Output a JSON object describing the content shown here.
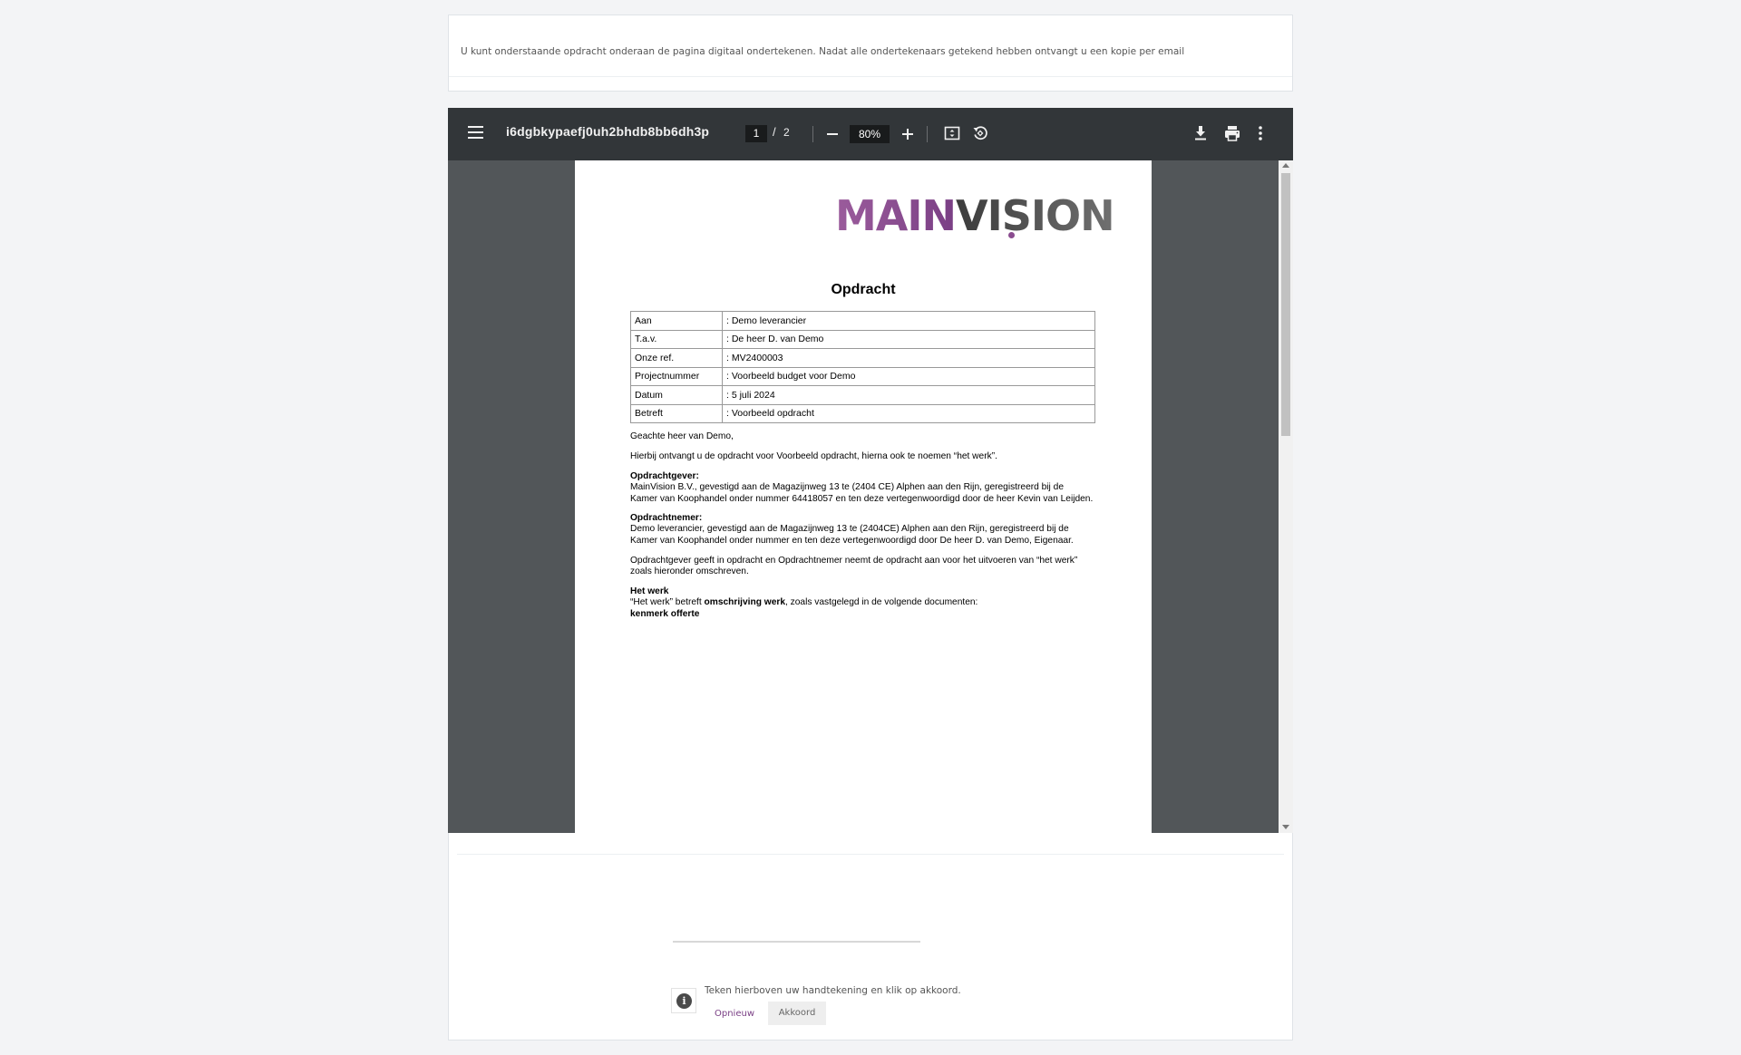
{
  "notice": {
    "text": "U kunt onderstaande opdracht onderaan de pagina digitaal ondertekenen. Nadat alle ondertekenaars getekend hebben ontvangt u een kopie per email"
  },
  "viewer": {
    "title": "i6dgbkypaefj0uh2bhdb8bb6dh3p",
    "page_current": "1",
    "page_separator": "/",
    "page_total": "2",
    "zoom": "80%",
    "icons": [
      "menu-icon",
      "zoom-out-icon",
      "zoom-in-icon",
      "fit-page-icon",
      "rotate-icon",
      "download-icon",
      "print-icon",
      "more-options-icon"
    ]
  },
  "document": {
    "logo_main": "MAIN",
    "logo_vision": "VISION",
    "heading": "Opdracht",
    "table": [
      {
        "key": "Aan",
        "value": ": Demo leverancier"
      },
      {
        "key": "T.a.v.",
        "value": ": De heer D. van Demo"
      },
      {
        "key": "Onze ref.",
        "value": ": MV2400003"
      },
      {
        "key": "Projectnummer",
        "value": ": Voorbeeld budget voor Demo"
      },
      {
        "key": "Datum",
        "value": ": 5 juli 2024"
      },
      {
        "key": "Betreft",
        "value": ": Voorbeeld opdracht"
      }
    ],
    "salutation": "Geachte heer van Demo,",
    "intro": "Hierbij ontvangt u de opdracht voor Voorbeeld opdracht, hierna ook te noemen “het werk”.",
    "client_heading": "Opdrachtgever:",
    "client_line1": "MainVision B.V., gevestigd aan de Magazijnweg 13 te (2404 CE) Alphen aan den Rijn, geregistreerd bij de",
    "client_line2": "Kamer van Koophandel onder nummer 64418057 en ten deze vertegenwoordigd door de heer Kevin van Leijden.",
    "contractor_heading": "Opdrachtnemer:",
    "contractor_line1": "Demo leverancier, gevestigd aan de Magazijnweg 13 te (2404CE) Alphen aan den Rijn, geregistreerd bij de",
    "contractor_line2": "Kamer van Koophandel onder nummer   en ten deze vertegenwoordigd door De heer D. van Demo, Eigenaar.",
    "assignment_line1": "Opdrachtgever geeft in opdracht en Opdrachtnemer neemt de opdracht aan voor het uitvoeren van “het werk”",
    "assignment_line2": "zoals hieronder omschreven.",
    "work_heading": "Het werk",
    "work_prefix": "“Het werk” betreft ",
    "work_bold": "omschrijving werk",
    "work_suffix": ", zoals vastgelegd in de volgende documenten:",
    "work_ref": "kenmerk offerte"
  },
  "signature": {
    "hint": "Teken hierboven uw handtekening en klik op akkoord.",
    "reset_label": "Opnieuw",
    "accept_label": "Akkoord",
    "info_glyph": "i"
  },
  "colors": {
    "toolbar": "#323639",
    "viewer_bg": "#525659",
    "accent": "#7a3f85"
  }
}
